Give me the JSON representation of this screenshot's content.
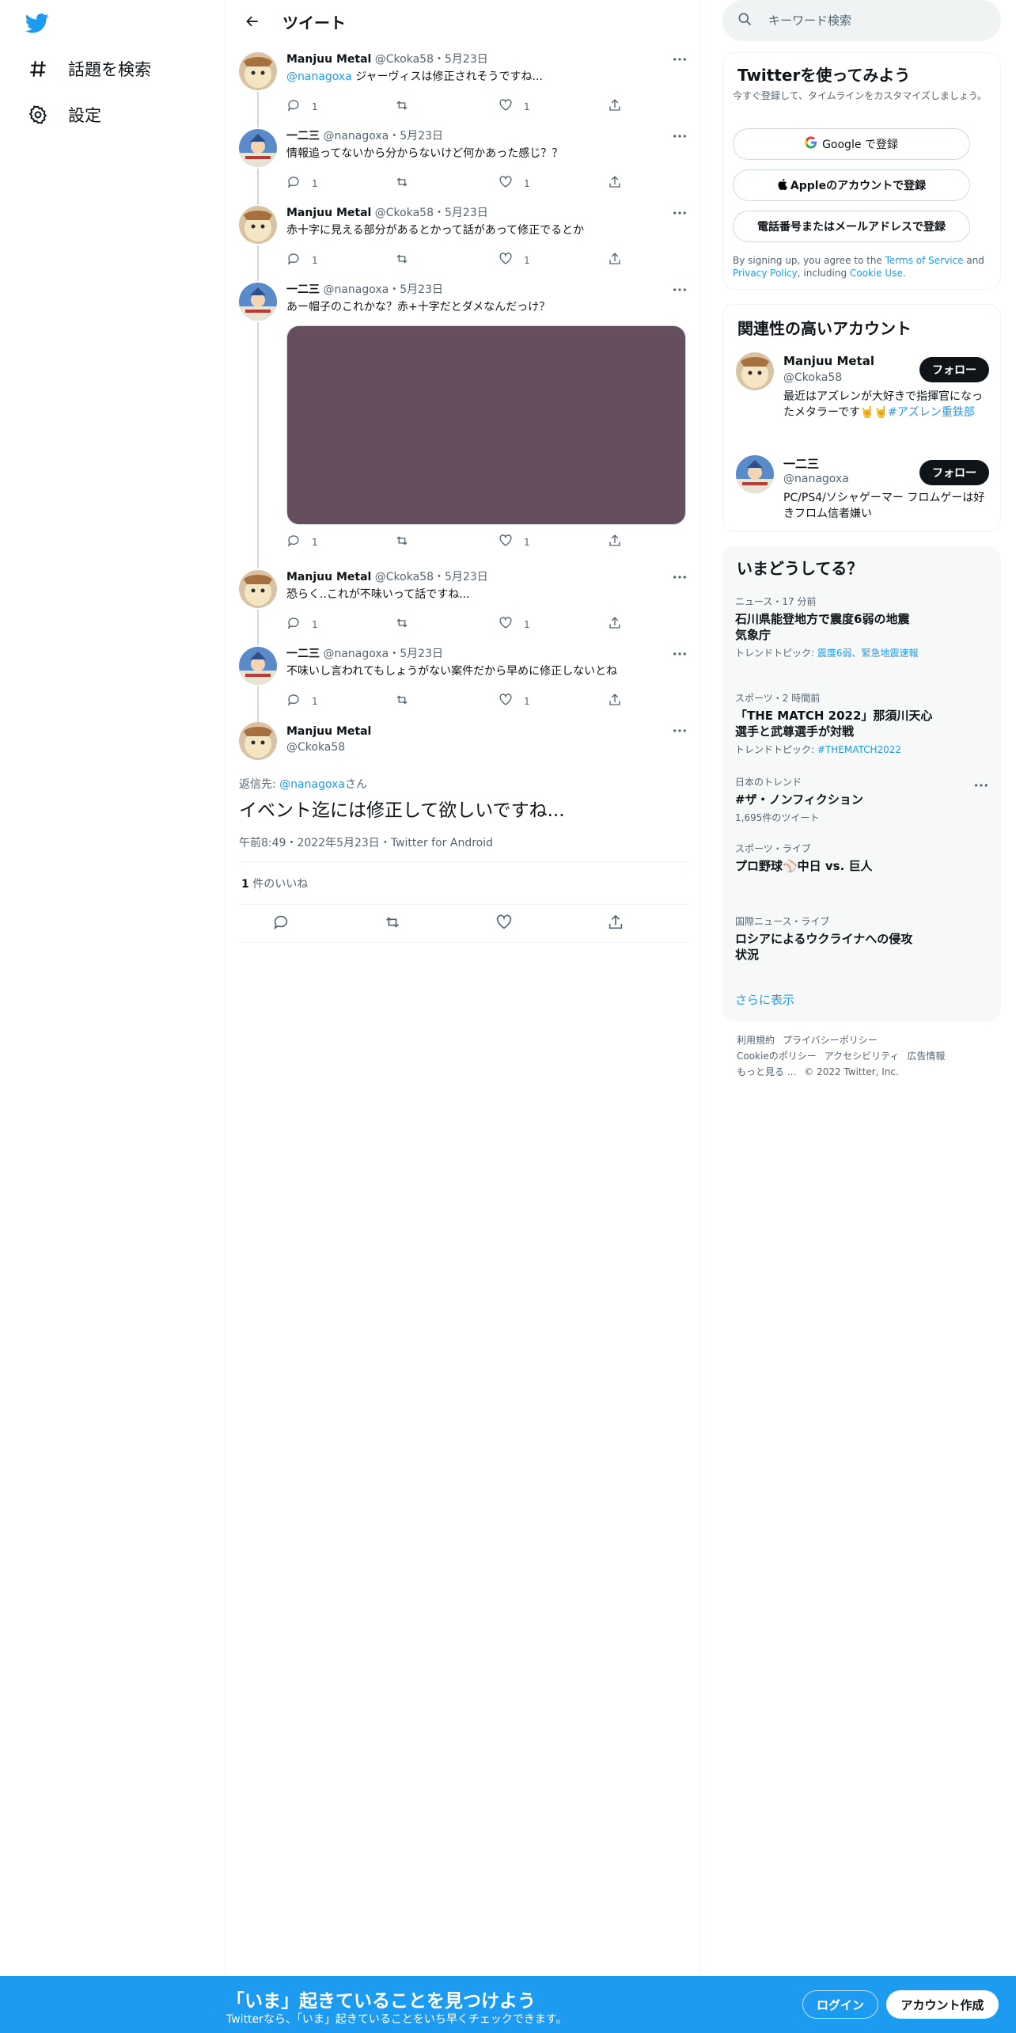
{
  "nav": {
    "items": [
      {
        "label": "話題を検索",
        "icon": "hashtag-icon"
      },
      {
        "label": "設定",
        "icon": "gear-icon"
      }
    ]
  },
  "header": {
    "title": "ツイート"
  },
  "thread": [
    {
      "name": "Manjuu Metal",
      "handle": "@Ckoka58",
      "date": "5月23日",
      "mention": "@nanagoxa",
      "text": " ジャーヴィスは修正されそうですね...",
      "replies": "1",
      "likes": "1"
    },
    {
      "name": "一二三",
      "handle": "@nanagoxa",
      "date": "5月23日",
      "text": "情報追ってないから分からないけど何かあった感じ？？",
      "replies": "1",
      "likes": "1"
    },
    {
      "name": "Manjuu Metal",
      "handle": "@Ckoka58",
      "date": "5月23日",
      "text": "赤十字に見える部分があるとかって話があって修正でるとか",
      "replies": "1",
      "likes": "1"
    },
    {
      "name": "一二三",
      "handle": "@nanagoxa",
      "date": "5月23日",
      "text": "あー帽子のこれかな？赤+十字だとダメなんだっけ？",
      "replies": "1",
      "likes": "1"
    },
    {
      "name": "Manjuu Metal",
      "handle": "@Ckoka58",
      "date": "5月23日",
      "text": "恐らく..これが不味いって話ですね...",
      "replies": "1",
      "likes": "1"
    },
    {
      "name": "一二三",
      "handle": "@nanagoxa",
      "date": "5月23日",
      "text": "不味いし言われてもしょうがない案件だから早めに修正しないとね",
      "replies": "1",
      "likes": "1"
    }
  ],
  "focus": {
    "name": "Manjuu Metal",
    "handle": "@Ckoka58",
    "reply_prefix": "返信先: ",
    "reply_mention": "@nanagoxa",
    "reply_suffix": "さん",
    "text": "イベント迄には修正して欲しいですね...",
    "time": "午前8:49",
    "date": "2022年5月23日",
    "client": "Twitter for Android",
    "like_count": "1",
    "like_label": " 件のいいね"
  },
  "search": {
    "placeholder": "キーワード検索"
  },
  "signup_card": {
    "title": "Twitterを使ってみよう",
    "subtitle": "今すぐ登録して、タイムラインをカスタマイズしましょう。",
    "google": "Google で登録",
    "apple": "Appleのアカウントで登録",
    "phone": "電話番号またはメールアドレスで登録",
    "legal_1": "By signing up, you agree to the ",
    "tos": "Terms of Service",
    "legal_2": " and ",
    "privacy": "Privacy Policy",
    "legal_3": ", including ",
    "cookie": "Cookie Use",
    "legal_4": "."
  },
  "who_to_follow": {
    "title": "関連性の高いアカウント",
    "follow_label": "フォロー",
    "accounts": [
      {
        "name": "Manjuu Metal",
        "handle": "@Ckoka58",
        "bio": "最近はアズレンが大好きで指揮官になったメタラーです🤘🤘",
        "bio_tag": "#アズレン重鉄部"
      },
      {
        "name": "一二三",
        "handle": "@nanagoxa",
        "bio": "PC/PS4/ソシャゲーマー フロムゲーは好きフロム信者嫌い"
      }
    ]
  },
  "trends": {
    "title": "いまどうしてる？",
    "items": [
      {
        "category": "ニュース・17 分前",
        "title": "石川県能登地方で震度6弱の地震 気象庁",
        "sub_prefix": "トレンドトピック: ",
        "sub_link": "震度6弱、緊急地震速報"
      },
      {
        "category": "スポーツ・2 時間前",
        "title": "「THE MATCH 2022」那須川天心選手と武尊選手が対戦",
        "sub_prefix": "トレンドトピック: ",
        "sub_link": "#THEMATCH2022"
      },
      {
        "category": "日本のトレンド",
        "title": "#ザ・ノンフィクション",
        "count": "1,695件のツイート"
      },
      {
        "category": "スポーツ・ライブ",
        "title": "プロ野球⚾中日 vs. 巨人"
      },
      {
        "category": "国際ニュース・ライブ",
        "title": "ロシアによるウクライナへの侵攻状況"
      }
    ],
    "show_more": "さらに表示"
  },
  "footer": {
    "links": [
      "利用規約",
      "プライバシーポリシー",
      "Cookieのポリシー",
      "アクセシビリティ",
      "広告情報",
      "もっと見る ..."
    ],
    "copyright": "© 2022 Twitter, Inc."
  },
  "bottom_bar": {
    "title": "「いま」起きていることを見つけよう",
    "subtitle": "Twitterなら、「いま」起きていることをいち早くチェックできます。",
    "login": "ログイン",
    "signup": "アカウント作成"
  },
  "colors": {
    "accent": "#1d9bf0",
    "text": "#0f1419",
    "muted": "#536471",
    "media": "#654f5e"
  }
}
